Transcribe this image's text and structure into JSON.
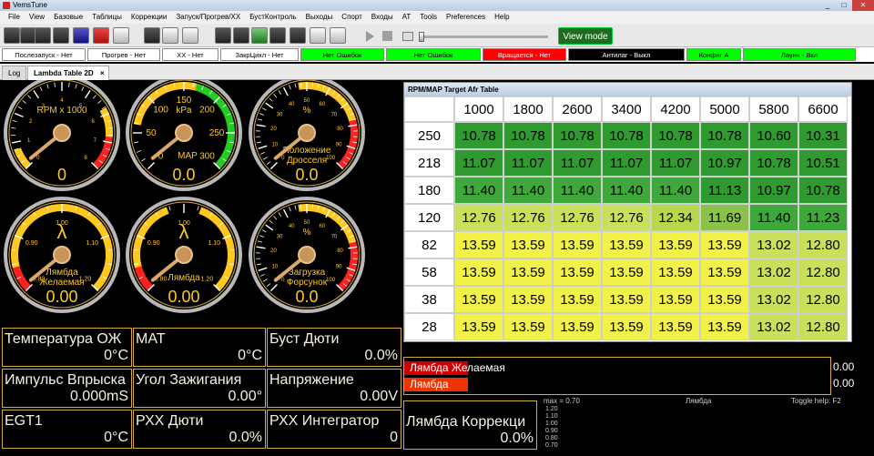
{
  "window": {
    "title": "VemsTune"
  },
  "menu": [
    "File",
    "View",
    "Базовые",
    "Таблицы",
    "Коррекции",
    "Запуск/Прогрев/ХХ",
    "БустКонтроль",
    "Выходы",
    "Спорт",
    "Входы",
    "AT",
    "Tools",
    "Preferences",
    "Help"
  ],
  "toolbar": {
    "view_mode_label": "View mode"
  },
  "status": [
    {
      "text": "Послезапуск - Нет",
      "bg": "#ffffff",
      "fg": "#000000"
    },
    {
      "text": "Прогрев - Нет",
      "bg": "#ffffff",
      "fg": "#000000"
    },
    {
      "text": "ХХ - Нет",
      "bg": "#ffffff",
      "fg": "#000000"
    },
    {
      "text": "ЗакрЦикл - Нет",
      "bg": "#ffffff",
      "fg": "#000000"
    },
    {
      "text": "Нет Ошибок",
      "bg": "#00ff00",
      "fg": "#000000"
    },
    {
      "text": "Нет Ошибок",
      "bg": "#00ff00",
      "fg": "#000000"
    },
    {
      "text": "Вращается - Нет",
      "bg": "#ff0000",
      "fg": "#ffffff"
    },
    {
      "text": "Антилаг - Выкл",
      "bg": "#000000",
      "fg": "#ffffff"
    },
    {
      "text": "Конфиг А",
      "bg": "#00ff00",
      "fg": "#000000"
    },
    {
      "text": "Лаунч - Вкл",
      "bg": "#00ff00",
      "fg": "#000000"
    }
  ],
  "tabs": [
    {
      "label": "Log"
    },
    {
      "label": "Lambda Table 2D"
    }
  ],
  "gauges": [
    {
      "title": "RPM x 1000",
      "value": "0",
      "ticks": [
        "0",
        "1",
        "2",
        "3",
        "4",
        "5",
        "6",
        "7",
        "8"
      ]
    },
    {
      "title": "kPa",
      "sub": "MAP",
      "value": "0.0",
      "ticks": [
        "0",
        "50",
        "100",
        "150",
        "200",
        "250",
        "300"
      ]
    },
    {
      "title": "%",
      "sub": "Положение Дросселя",
      "value": "0.0",
      "ticks": [
        "0",
        "10",
        "20",
        "30",
        "40",
        "50",
        "60",
        "70",
        "80",
        "90",
        "100"
      ]
    },
    {
      "title": "λ",
      "sub": "Лямбда Желаемая",
      "value": "0.00",
      "ticks": [
        "0.80",
        "0.90",
        "1.00",
        "1.10",
        "1.20"
      ]
    },
    {
      "title": "λ",
      "sub": "Лямбда",
      "value": "0.00",
      "ticks": [
        "0.80",
        "0.90",
        "1.00",
        "1.10",
        "1.20"
      ]
    },
    {
      "title": "%",
      "sub": "Загрузка Форсунок",
      "value": "0.0",
      "ticks": [
        "0",
        "10",
        "20",
        "30",
        "40",
        "50",
        "60",
        "70",
        "80",
        "90",
        "100"
      ]
    }
  ],
  "table": {
    "title": "RPM/MAP Target Afr Table",
    "rpm": [
      "1000",
      "1800",
      "2600",
      "3400",
      "4200",
      "5000",
      "5800",
      "6600"
    ],
    "map": [
      "250",
      "218",
      "180",
      "120",
      "82",
      "58",
      "38",
      "28"
    ],
    "rows": [
      [
        "10.78",
        "10.78",
        "10.78",
        "10.78",
        "10.78",
        "10.78",
        "10.60",
        "10.31"
      ],
      [
        "11.07",
        "11.07",
        "11.07",
        "11.07",
        "11.07",
        "10.97",
        "10.78",
        "10.51"
      ],
      [
        "11.40",
        "11.40",
        "11.40",
        "11.40",
        "11.40",
        "11.13",
        "10.97",
        "10.78"
      ],
      [
        "12.76",
        "12.76",
        "12.76",
        "12.76",
        "12.34",
        "11.69",
        "11.40",
        "11.23"
      ],
      [
        "13.59",
        "13.59",
        "13.59",
        "13.59",
        "13.59",
        "13.59",
        "13.02",
        "12.80"
      ],
      [
        "13.59",
        "13.59",
        "13.59",
        "13.59",
        "13.59",
        "13.59",
        "13.02",
        "12.80"
      ],
      [
        "13.59",
        "13.59",
        "13.59",
        "13.59",
        "13.59",
        "13.59",
        "13.02",
        "12.80"
      ],
      [
        "13.59",
        "13.59",
        "13.59",
        "13.59",
        "13.59",
        "13.59",
        "13.02",
        "12.80"
      ]
    ]
  },
  "readouts": [
    {
      "label": "Температура ОЖ",
      "value": "0°C"
    },
    {
      "label": "MAT",
      "value": "0°C"
    },
    {
      "label": "Буст Дюти",
      "value": "0.0%"
    },
    {
      "label": "Импульс Впрыска",
      "value": "0.000mS"
    },
    {
      "label": "Угол Зажигания",
      "value": "0.00°"
    },
    {
      "label": "Напряжение",
      "value": "0.00V"
    },
    {
      "label": "EGT1",
      "value": "0°C"
    },
    {
      "label": "РХХ Дюти",
      "value": "0.0%"
    },
    {
      "label": "РХХ Интегратор",
      "value": "0"
    }
  ],
  "bars": [
    {
      "label": "Лямбда Желаемая",
      "value": "0.00"
    },
    {
      "label": "Лямбда",
      "value": "0.00"
    }
  ],
  "correction": {
    "label": "Лямбда Коррекци",
    "value": "0.0%"
  },
  "graph": {
    "max_label": "max = 0.70",
    "series_label": "Лямбда",
    "help": "Toggle help: F2",
    "y_ticks": [
      "1.20",
      "1.10",
      "1.00",
      "0.90",
      "0.80",
      "0.70"
    ]
  }
}
